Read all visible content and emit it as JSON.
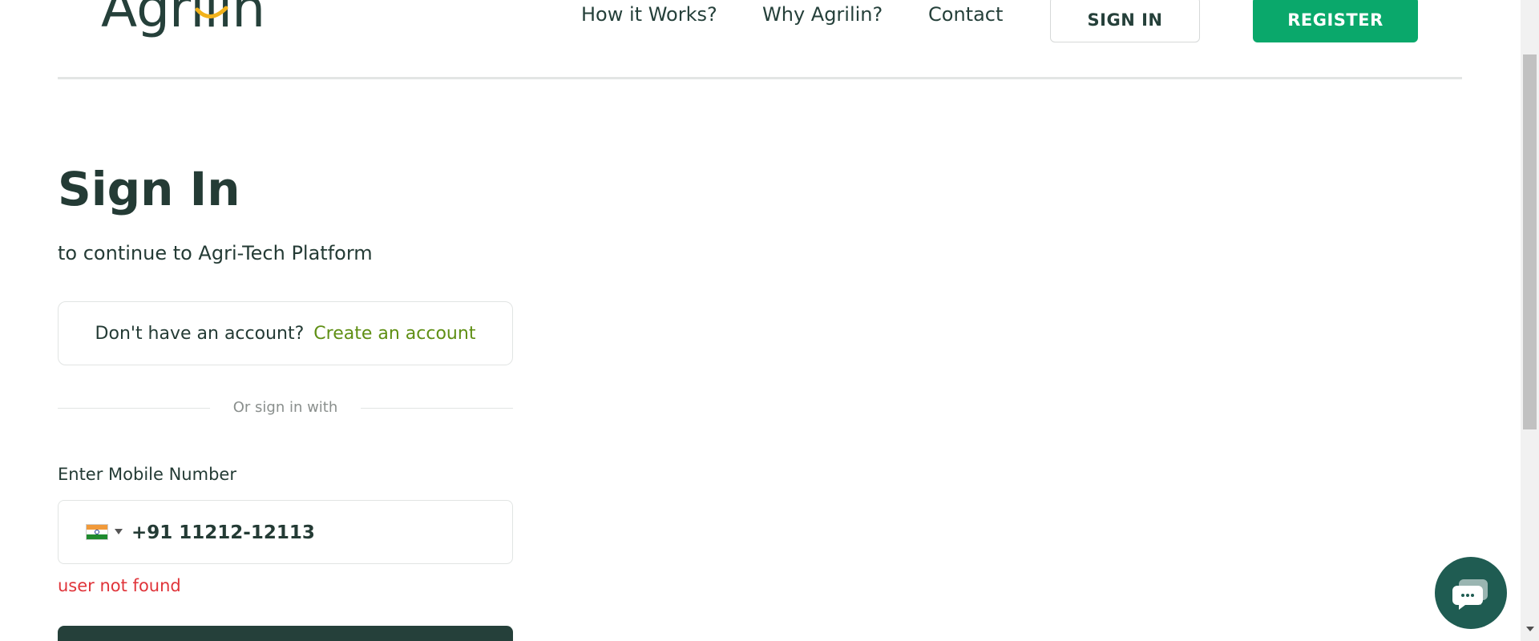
{
  "header": {
    "logo_text": "Agrilin",
    "nav": {
      "how_it_works": "How it Works?",
      "why_agrilin": "Why Agrilin?",
      "contact": "Contact"
    },
    "sign_in_label": "SIGN IN",
    "register_label": "REGISTER"
  },
  "signin": {
    "title": "Sign In",
    "subtitle": "to continue to Agri-Tech Platform",
    "no_account_text": "Don't have an account?",
    "create_account_link": "Create an account",
    "divider_text": "Or sign in with",
    "mobile_label": "Enter Mobile Number",
    "phone_value": "+91 11212-12113",
    "country_flag": "india-flag-icon",
    "error_text": "user not found"
  },
  "chat": {
    "icon": "chat-bubble-icon"
  },
  "colors": {
    "primary_dark": "#25403a",
    "brand_green": "#0aa86b",
    "link_green": "#5f8f14",
    "error_red": "#e0343a",
    "chat_bg": "#1f5c52"
  }
}
